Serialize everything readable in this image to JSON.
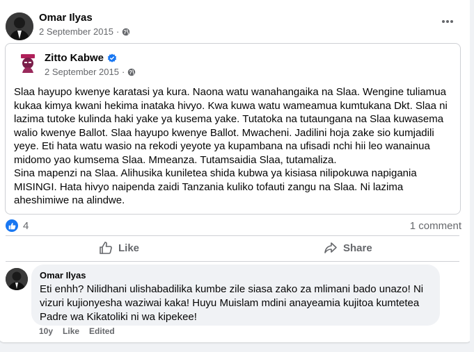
{
  "post": {
    "author": "Omar Ilyas",
    "date": "2 September 2015",
    "privacy_icon": "globe-icon",
    "more_icon": "more-options-icon"
  },
  "shared_post": {
    "author": "Zitto Kabwe",
    "verified_icon": "verified-badge-icon",
    "date": "2 September 2015",
    "privacy_icon": "globe-icon",
    "paragraphs": [
      "Slaa hayupo kwenye karatasi ya kura. Naona watu wanahangaika na Slaa. Wengine tuliamua kukaa kimya kwani hekima inataka hivyo. Kwa kuwa watu wameamua kumtukana Dkt. Slaa ni lazima tutoke kulinda haki yake ya kusema yake. Tutatoka na tutaungana na Slaa kuwasema walio kwenye Ballot. Slaa hayupo kwenye Ballot. Mwacheni. Jadilini hoja zake sio kumjadili yeye. Eti hata watu wasio na rekodi yeyote ya kupambana na ufisadi nchi hii leo wanainua midomo yao kumsema Slaa. Mmeanza. Tutamsaidia Slaa, tutamaliza.",
      "Sina mapenzi na Slaa. Alihusika kuniletea shida kubwa ya kisiasa nilipokuwa napigania MISINGI. Hata hivyo naipenda zaidi Tanzania kuliko tofauti zangu na Slaa. Ni lazima aheshimiwe na alindwe."
    ]
  },
  "reactions": {
    "count": "4",
    "comments": "1 comment",
    "colors": {
      "like_blue": "#1877f2",
      "muted": "#65676b"
    }
  },
  "actions": {
    "like": "Like",
    "share": "Share"
  },
  "comment": {
    "author": "Omar Ilyas",
    "text": "Eti enhh? Nilidhani ulishabadilika kumbe zile siasa zako za mlimani bado unazo! Ni vizuri kujionyesha waziwai kaka! Huyu Muislam mdini anayeamia kujitoa kumtetea Padre wa Kikatoliki ni wa kipekee!",
    "age": "10y",
    "like": "Like",
    "edited": "Edited"
  }
}
